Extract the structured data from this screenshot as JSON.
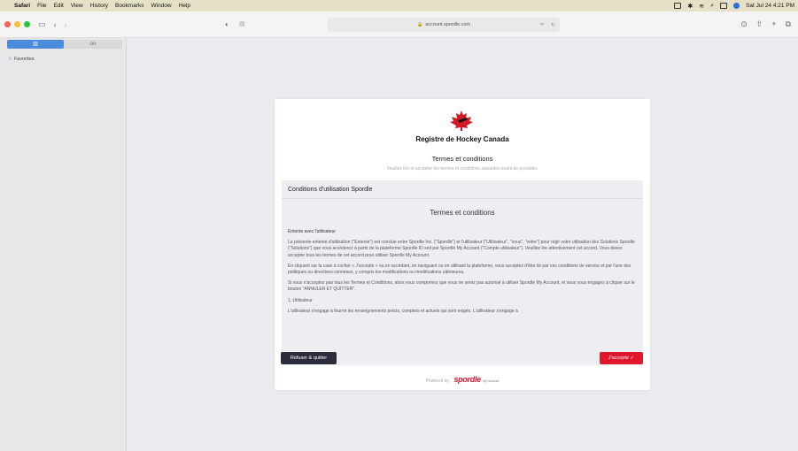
{
  "menubar": {
    "app": "Safari",
    "items": [
      "File",
      "Edit",
      "View",
      "History",
      "Bookmarks",
      "Window",
      "Help"
    ],
    "clock": "Sat Jul 24 4:21 PM"
  },
  "toolbar": {
    "url": "account.spordle.com",
    "colors": {
      "close": "#fd5f57",
      "minimize": "#febc2e",
      "zoom": "#28c840"
    }
  },
  "sidebar": {
    "tab_bookmarks": "▥",
    "tab_reading": "oo",
    "favorites": "Favorites"
  },
  "page": {
    "brand_title": "Registre de Hockey Canada",
    "terms_heading": "Termes et conditions",
    "terms_subtitle": "Veuillez lire et accepter les termes et conditions suivantes avant de procéder.",
    "panel_title": "Conditions d'utilisation Spordle",
    "panel_heading": "Termes et conditions",
    "section_heading": "Entente avec l'utilisateur",
    "para1": "La présente entente d'utilisation (\"Entente\") est conclue entre Spordle Inc. (\"Spordle\") et l'utilisateur (\"Utilisateur\", \"vous\", \"votre\") pour régir votre utilisation des Solutions Spordle (\"Solutions\") que vous accéderez à partir de la plateforme Spordle ID soit par Spordle My Account (\"Compte utilisateur\"). Veuillez lire attentivement cet accord. Vous devez accepter tous les termes de cet accord pour utiliser Spordle My Account.",
    "para2": "En cliquant sur la case à cocher « J'accepte » ou en accédant, en naviguant ou en utilisant la plateforme, vous acceptez d'être lié par ces conditions de service et par l'une des politiques ou directives connexes, y compris les modifications ou modifications ultérieures.",
    "para3": "Si vous n'acceptez pas tous les Termes et Conditions, alors vous comprenez que vous ne serez pas autorisé à utiliser Spordle My Account, et vous vous engagez à cliquer sur le bouton \"ANNULER ET QUITTER\".",
    "section1": "1. Utilisateur",
    "para4": "L'utilisateur s'engage à fournir les renseignements précis, complets et actuels qui sont exigés. L'utilisateur s'engage à",
    "refuse_label": "Refuser & quitter",
    "accept_label": "J'accepte ✓",
    "powered_by": "Powered by",
    "spordle": "spordle",
    "my_account": "My Account"
  }
}
